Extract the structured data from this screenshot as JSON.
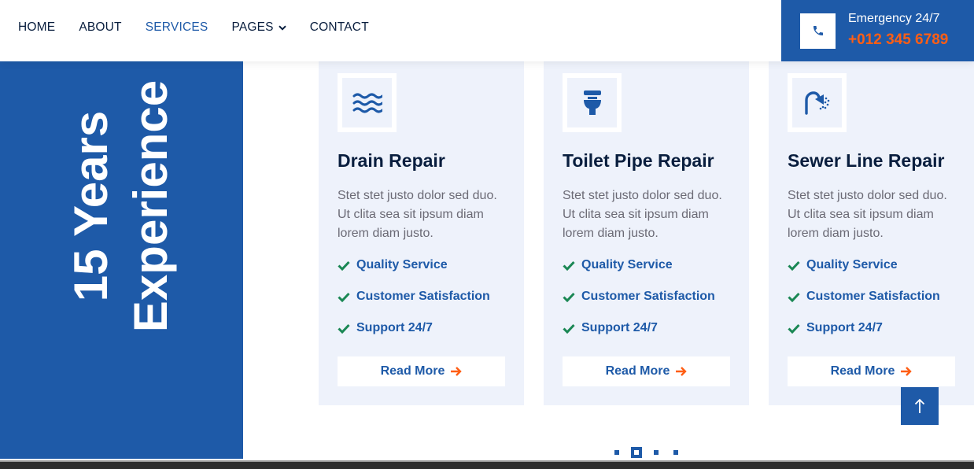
{
  "nav": {
    "items": [
      {
        "label": "HOME",
        "active": false
      },
      {
        "label": "ABOUT",
        "active": false
      },
      {
        "label": "SERVICES",
        "active": true
      },
      {
        "label": "PAGES",
        "active": false,
        "dropdown": true
      },
      {
        "label": "CONTACT",
        "active": false
      }
    ],
    "emergency": {
      "title": "Emergency 24/7",
      "phone": "+012 345 6789",
      "icon": "phone-icon"
    }
  },
  "experience": {
    "line1": "15 Years",
    "line2": "Experience"
  },
  "services": [
    {
      "icon": "water-waves-icon",
      "title": "Drain Repair",
      "description": "Stet stet justo dolor sed duo. Ut clita sea sit ipsum diam lorem diam justo.",
      "features": [
        "Quality Service",
        "Customer Satisfaction",
        "Support 24/7"
      ],
      "button": "Read More"
    },
    {
      "icon": "toilet-icon",
      "title": "Toilet Pipe Repair",
      "description": "Stet stet justo dolor sed duo. Ut clita sea sit ipsum diam lorem diam justo.",
      "features": [
        "Quality Service",
        "Customer Satisfaction",
        "Support 24/7"
      ],
      "button": "Read More"
    },
    {
      "icon": "shower-icon",
      "title": "Sewer Line Repair",
      "description": "Stet stet justo dolor sed duo. Ut clita sea sit ipsum diam lorem diam justo.",
      "features": [
        "Quality Service",
        "Customer Satisfaction",
        "Support 24/7"
      ],
      "button": "Read More"
    }
  ],
  "carousel": {
    "dot_count": 4,
    "active_index": 1
  },
  "colors": {
    "primary": "#1E5AA8",
    "accent": "#FF5E14",
    "card_bg": "#EEF2FB",
    "check": "#1A8754",
    "heading": "#091E3E",
    "body_text": "#6B6A75"
  }
}
